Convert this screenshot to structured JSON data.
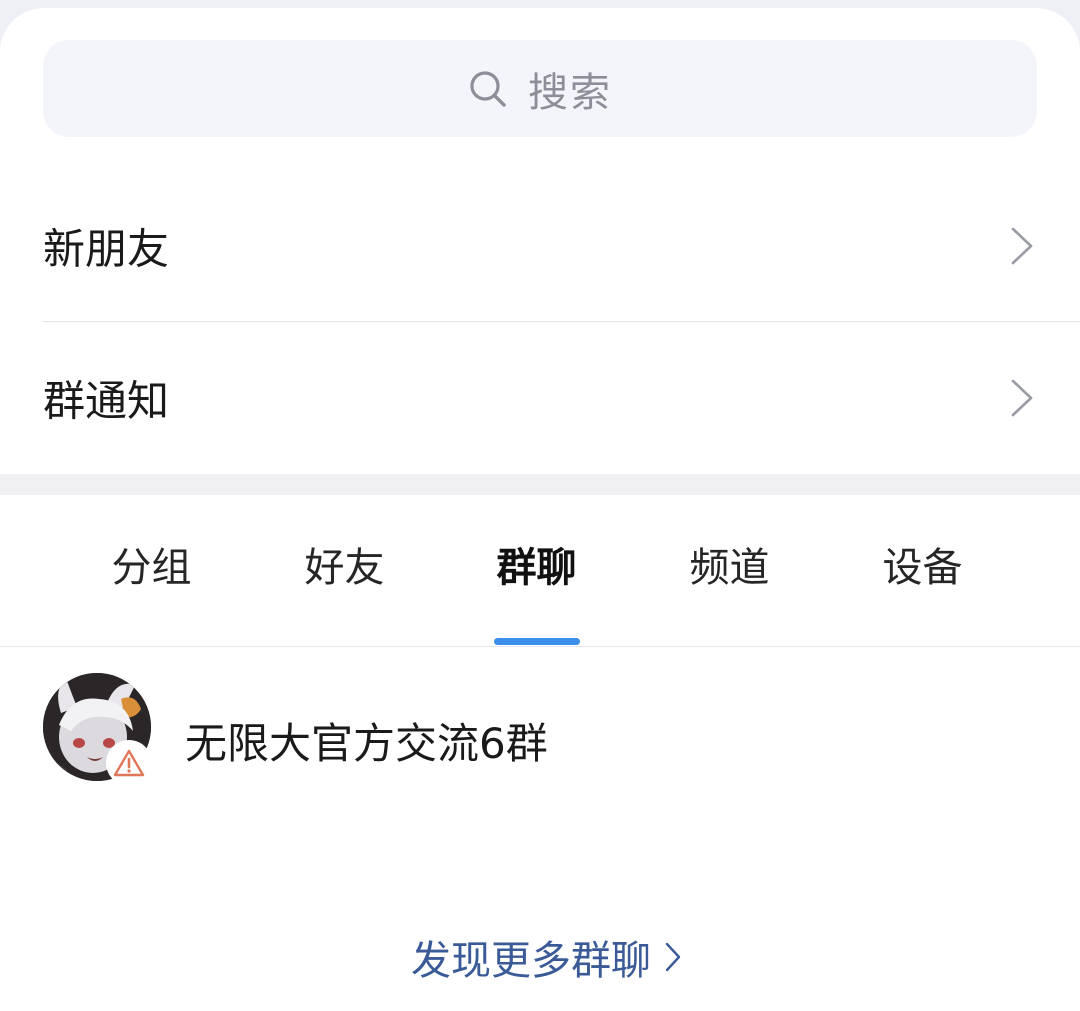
{
  "search": {
    "placeholder": "搜索",
    "icon": "search-icon"
  },
  "menu": {
    "new_friends": "新朋友",
    "group_notice": "群通知"
  },
  "tabs": [
    {
      "label": "分组",
      "active": false
    },
    {
      "label": "好友",
      "active": false
    },
    {
      "label": "群聊",
      "active": true
    },
    {
      "label": "频道",
      "active": false
    },
    {
      "label": "设备",
      "active": false
    }
  ],
  "groups": [
    {
      "name": "无限大官方交流6群",
      "badge_icon": "warning-icon"
    }
  ],
  "discover_more": "发现更多群聊",
  "colors": {
    "accent": "#3c8fe8",
    "link": "#3a5b97",
    "warning": "#e0765a"
  }
}
